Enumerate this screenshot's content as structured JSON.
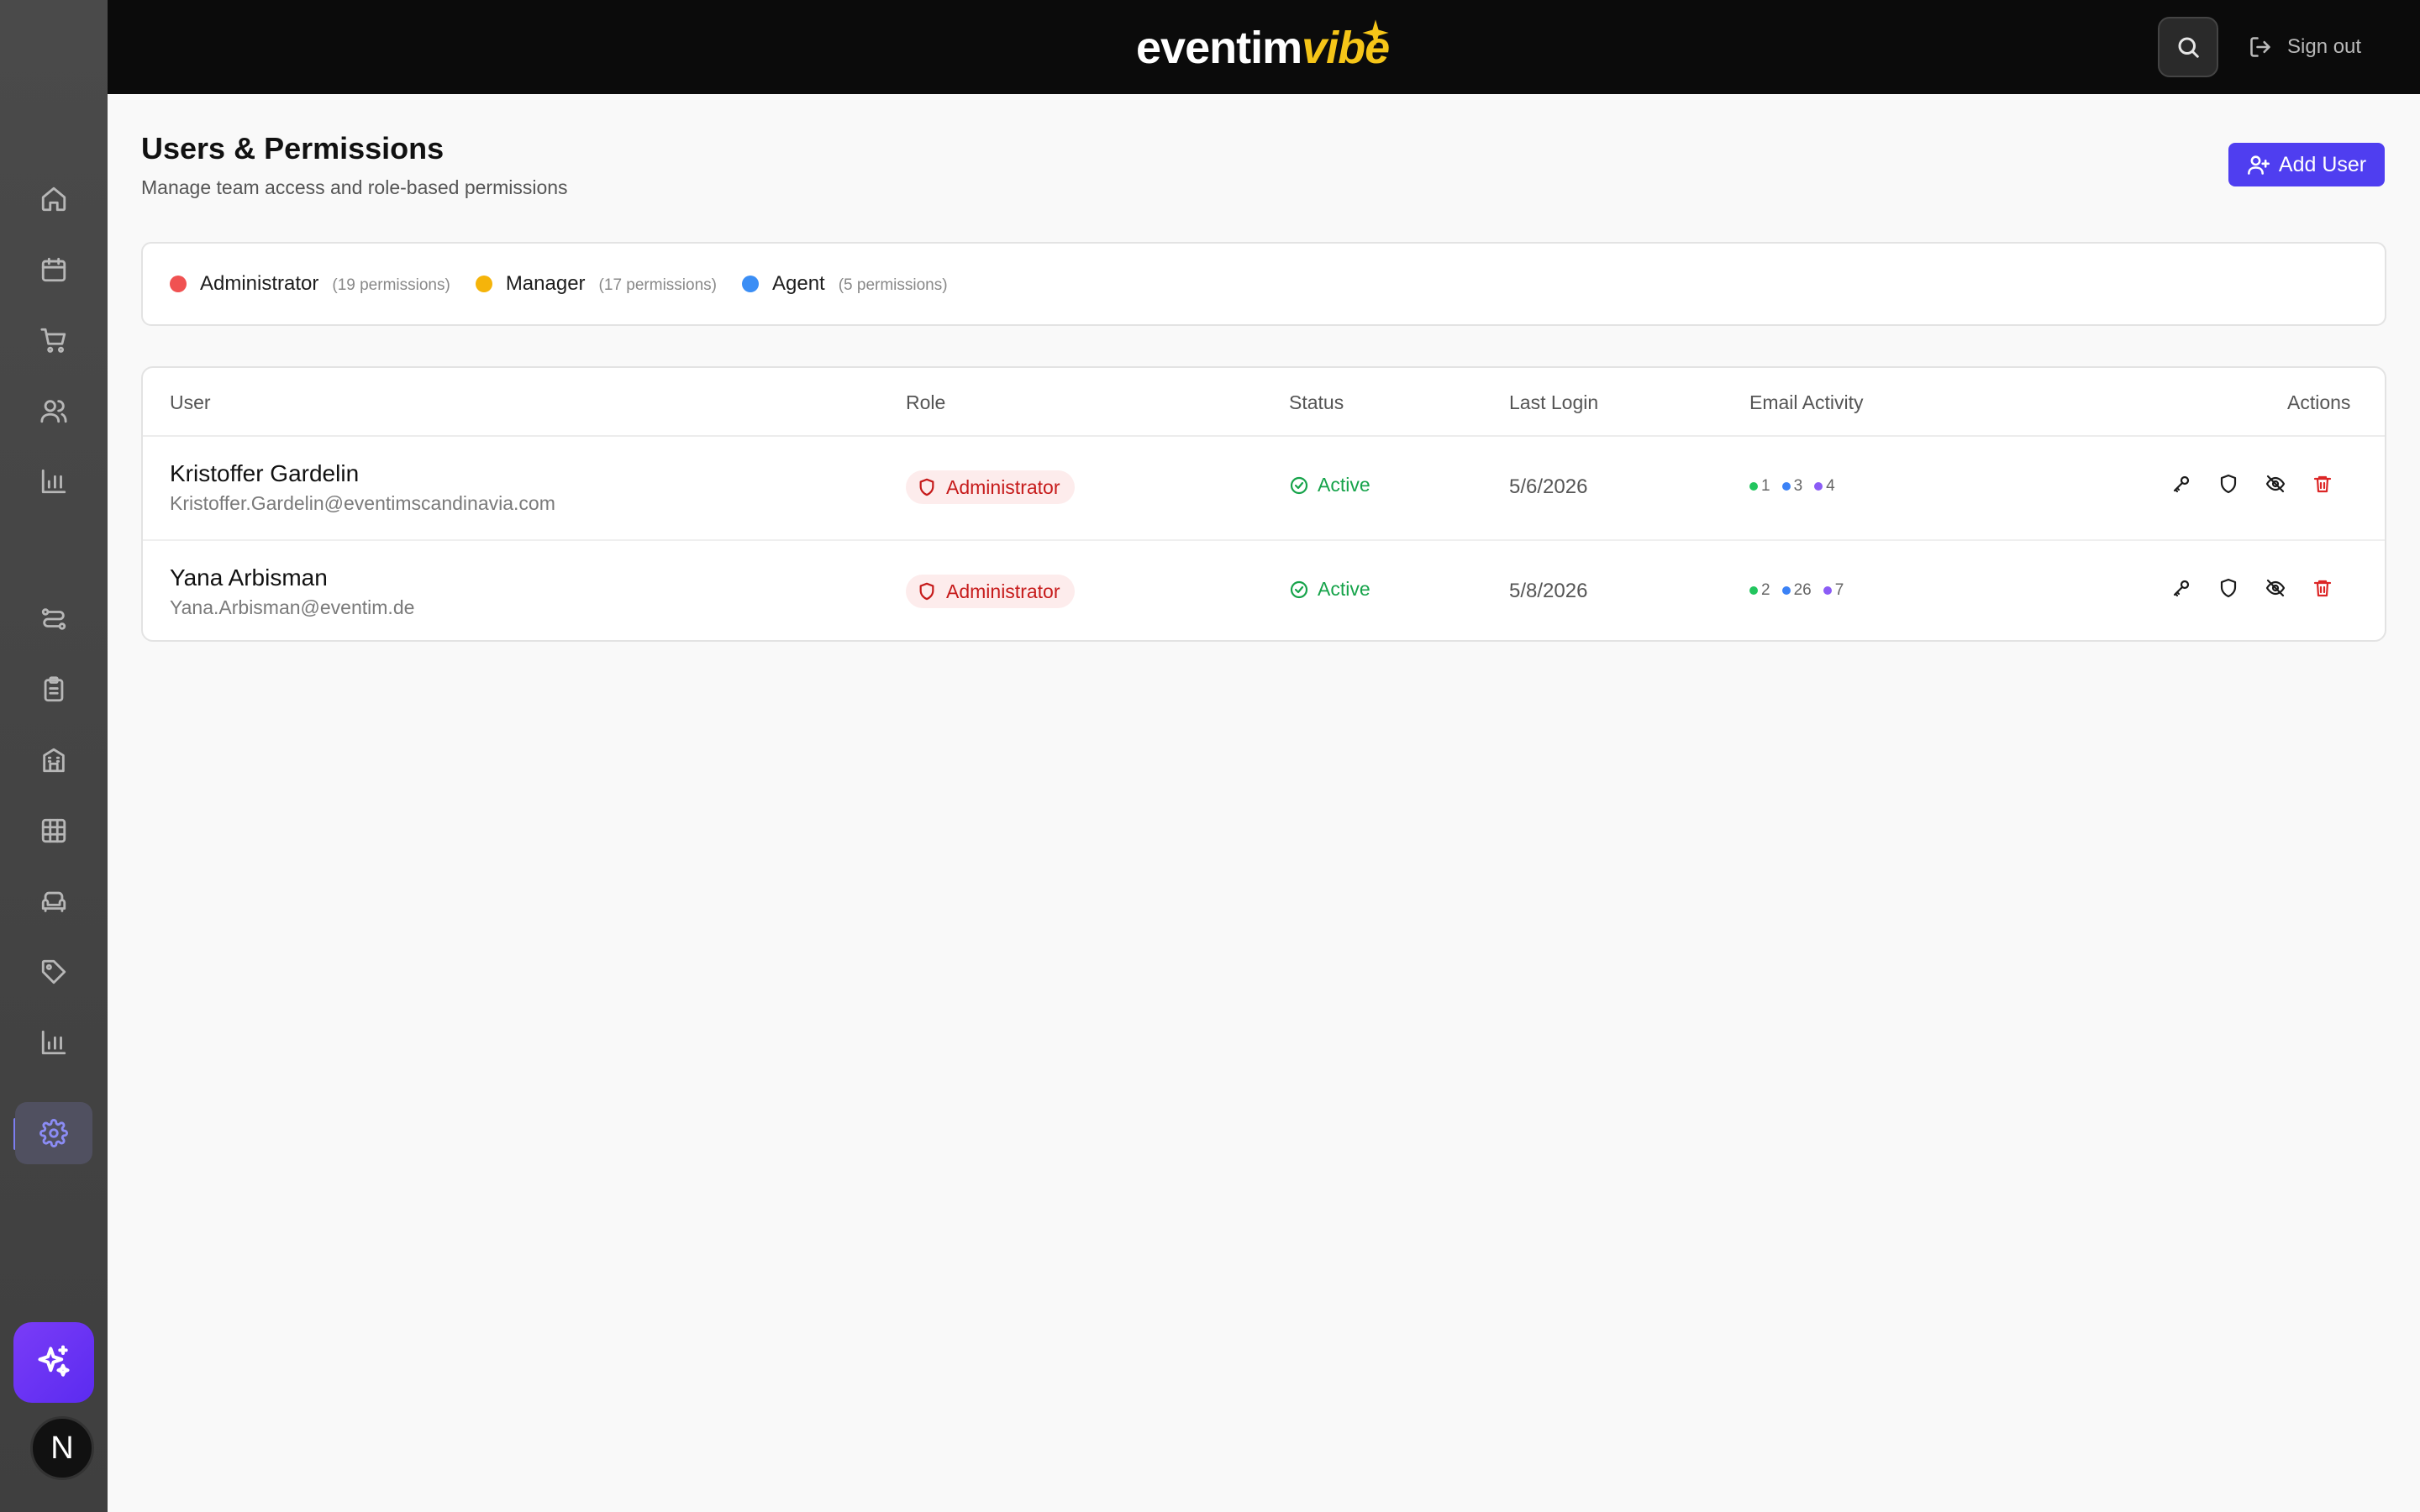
{
  "app": {
    "logo_word": "eventim",
    "logo_accent": "vibe"
  },
  "topbar": {
    "search_icon": "search-icon",
    "sign_out_label": "Sign out"
  },
  "sidebar": {
    "items": [
      {
        "name": "home",
        "icon": "home-icon"
      },
      {
        "name": "calendar",
        "icon": "calendar-icon"
      },
      {
        "name": "cart",
        "icon": "shopping-cart-icon"
      },
      {
        "name": "customers",
        "icon": "users-icon"
      },
      {
        "name": "analytics",
        "icon": "bar-chart-icon"
      },
      {
        "name": "flows",
        "icon": "route-icon"
      },
      {
        "name": "tasks",
        "icon": "clipboard-icon"
      },
      {
        "name": "venues",
        "icon": "building-icon"
      },
      {
        "name": "grid",
        "icon": "grid-icon"
      },
      {
        "name": "seating",
        "icon": "sofa-icon"
      },
      {
        "name": "tags",
        "icon": "tag-icon"
      },
      {
        "name": "reports",
        "icon": "bar-chart-icon"
      },
      {
        "name": "settings",
        "icon": "gear-icon",
        "active": true
      }
    ],
    "avatar_letter": "N"
  },
  "header": {
    "title": "Users & Permissions",
    "subtitle": "Manage team access and role-based permissions",
    "add_user_label": "Add User"
  },
  "roles": [
    {
      "name": "Administrator",
      "permissions": "(19 permissions)",
      "color": "#f05252"
    },
    {
      "name": "Manager",
      "permissions": "(17 permissions)",
      "color": "#f5b40a"
    },
    {
      "name": "Agent",
      "permissions": "(5 permissions)",
      "color": "#3b8ef5"
    }
  ],
  "table": {
    "columns": [
      "User",
      "Role",
      "Status",
      "Last Login",
      "Email Activity",
      "Actions"
    ],
    "rows": [
      {
        "name": "Kristoffer Gardelin",
        "email": "Kristoffer.Gardelin@eventimscandinavia.com",
        "role": "Administrator",
        "status": "Active",
        "last_login": "5/6/2026",
        "email_activity": [
          "1",
          "3",
          "4"
        ]
      },
      {
        "name": "Yana Arbisman",
        "email": "Yana.Arbisman@eventim.de",
        "role": "Administrator",
        "status": "Active",
        "last_login": "5/8/2026",
        "email_activity": [
          "2",
          "26",
          "7"
        ]
      }
    ]
  },
  "colors": {
    "accent": "#4f3ef0",
    "active_status": "#16a34a",
    "danger": "#dc2626",
    "email_dot_green": "#22c55e",
    "email_dot_blue": "#3b82f6",
    "email_dot_purple": "#8b5cf6"
  }
}
